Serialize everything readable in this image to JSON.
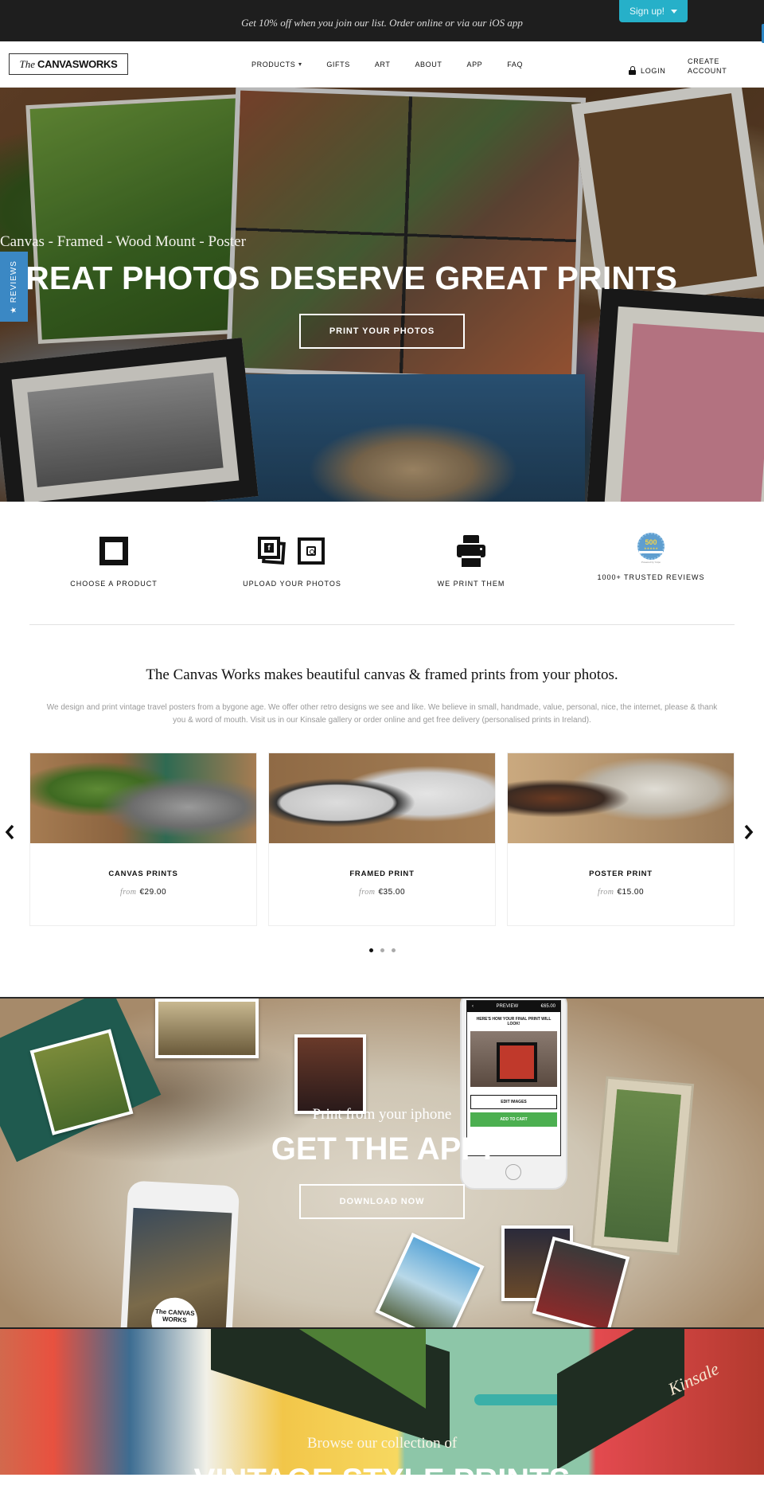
{
  "announcement": {
    "text": "Get 10% off when you join our list. Order online or via our iOS app",
    "signup_label": "Sign up!"
  },
  "header": {
    "logo_prefix": "The",
    "logo_main": "CANVASWORKS",
    "nav": [
      {
        "label": "PRODUCTS",
        "has_dropdown": true
      },
      {
        "label": "GIFTS"
      },
      {
        "label": "ART"
      },
      {
        "label": "ABOUT"
      },
      {
        "label": "APP"
      },
      {
        "label": "FAQ"
      }
    ],
    "login_label": "LOGIN",
    "create_account_line1": "CREATE",
    "create_account_line2": "ACCOUNT"
  },
  "reviews_tab": {
    "label": "★ REVIEWS",
    "color": "#3b88c4"
  },
  "hero": {
    "subtitle": "Canvas - Framed - Wood Mount - Poster",
    "title": "GREAT PHOTOS DESERVE GREAT PRINTS",
    "button_label": "PRINT YOUR PHOTOS"
  },
  "steps": [
    {
      "icon": "frame-icon",
      "label": "CHOOSE A PRODUCT"
    },
    {
      "icon": "upload-photos-icon",
      "label": "UPLOAD YOUR PHOTOS",
      "fb_glyph": "f"
    },
    {
      "icon": "printer-icon",
      "label": "WE PRINT THEM"
    },
    {
      "icon": "reviews-badge-icon",
      "label": "1000+ TRUSTED REVIEWS",
      "badge_number": "500",
      "badge_stars": "★★★★★",
      "badge_caption": "Powered by Yotpo"
    }
  ],
  "intro": {
    "heading": "The Canvas Works makes beautiful canvas & framed prints from your photos.",
    "body": "We design and print vintage travel posters from a bygone age. We offer other retro designs we see and like. We believe in small, handmade, value, personal, nice, the internet, please & thank you & word of mouth. Visit us in our Kinsale gallery or order online and get free delivery (personalised prints in Ireland)."
  },
  "products": [
    {
      "title": "CANVAS PRINTS",
      "from": "from",
      "price": "€29.00"
    },
    {
      "title": "FRAMED PRINT",
      "from": "from",
      "price": "€35.00"
    },
    {
      "title": "POSTER PRINT",
      "from": "from",
      "price": "€15.00"
    }
  ],
  "carousel": {
    "pages": 3,
    "active_page": 1
  },
  "app_section": {
    "subtitle": "Print from your iphone",
    "title": "GET THE APP!",
    "button_label": "DOWNLOAD NOW",
    "phone_preview_title": "PREVIEW",
    "phone_price": "€65.00",
    "phone_message": "HERE'S HOW YOUR FINAL PRINT WILL LOOK!",
    "phone_edit": "EDIT IMAGES",
    "phone_cart": "ADD TO CART",
    "phone_logo": "The CANVAS WORKS"
  },
  "vintage_section": {
    "subtitle": "Browse our collection of",
    "title": "VINTAGE STYLE PRINTS",
    "sign_text": "Kinsale"
  },
  "colors": {
    "signup_bg": "#26b0c9",
    "announce_bg": "#1e1e1e",
    "reviews_tab": "#3b88c4",
    "add_to_cart": "#4caf50"
  }
}
